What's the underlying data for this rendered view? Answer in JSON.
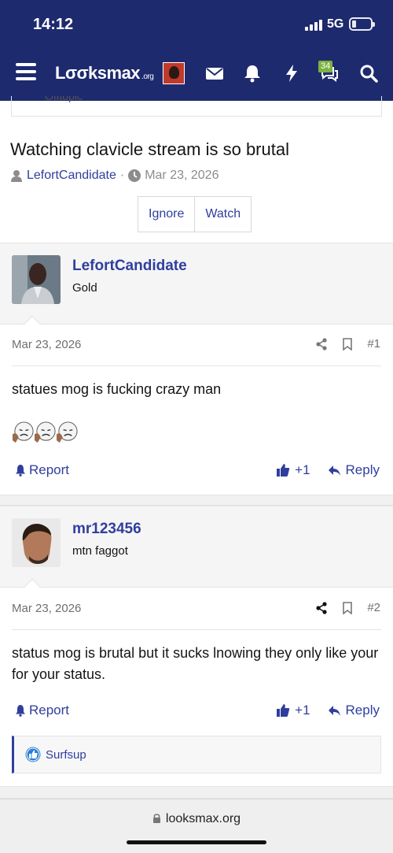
{
  "status": {
    "time": "14:12",
    "network": "5G"
  },
  "nav": {
    "logo": "Lσσksmax",
    "logo_suffix": ".org",
    "notification_count": "34"
  },
  "breadcrumb": {
    "label": "Offtopic"
  },
  "thread": {
    "title": "Watching clavicle stream is so brutal",
    "author": "LefortCandidate",
    "separator": "·",
    "date": "Mar 23, 2026",
    "ignore_label": "Ignore",
    "watch_label": "Watch"
  },
  "posts": [
    {
      "username": "LefortCandidate",
      "user_title": "Gold",
      "date": "Mar 23, 2026",
      "number": "#1",
      "body": "statues mog is fucking crazy man",
      "report_label": "Report",
      "like_label": "+1",
      "reply_label": "Reply"
    },
    {
      "username": "mr123456",
      "user_title": "mtn faggot",
      "date": "Mar 23, 2026",
      "number": "#2",
      "body": "status mog is brutal but it sucks lnowing they only like your for your status.",
      "report_label": "Report",
      "like_label": "+1",
      "reply_label": "Reply",
      "reaction_user": "Surfsup"
    }
  ],
  "browser": {
    "url": "looksmax.org"
  },
  "colors": {
    "header": "#1e2a6e",
    "link": "#2f3e9e",
    "badge": "#7cb342"
  }
}
